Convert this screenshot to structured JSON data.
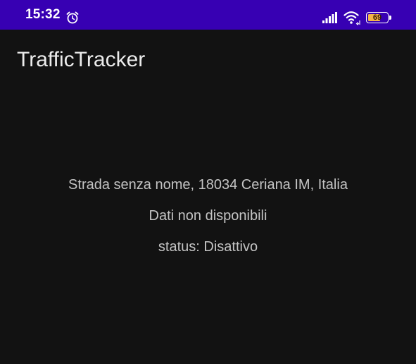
{
  "status_bar": {
    "time": "15:32",
    "battery_level": "69",
    "battery_fraction": 0.69,
    "icons": [
      "alarm-icon",
      "signal-icon",
      "wifi-icon",
      "battery-icon"
    ],
    "colors": {
      "background": "#3700b3",
      "battery_fill": "#f4b44a"
    }
  },
  "app_bar": {
    "title": "TrafficTracker"
  },
  "main": {
    "address": "Strada senza nome, 18034 Ceriana IM, Italia",
    "data_status": "Dati non disponibili",
    "status": "status: Disattivo"
  },
  "colors": {
    "background": "#121212",
    "text": "#c4c4c4"
  }
}
